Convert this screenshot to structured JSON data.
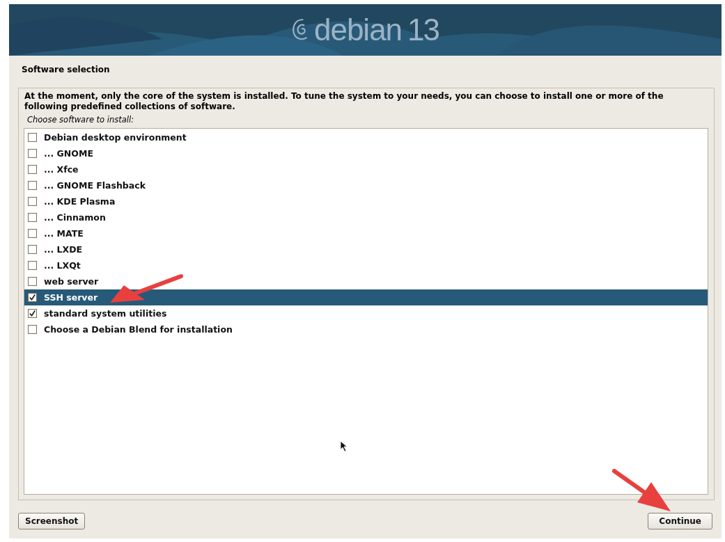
{
  "banner": {
    "logo_word": "debian",
    "logo_version": "13"
  },
  "title": "Software selection",
  "description": "At the moment, only the core of the system is installed. To tune the system to your needs, you can choose to install one or more of the following predefined collections of software.",
  "prompt": "Choose software to install:",
  "items": [
    {
      "label": "Debian desktop environment",
      "checked": false,
      "selected": false
    },
    {
      "label": "... GNOME",
      "checked": false,
      "selected": false
    },
    {
      "label": "... Xfce",
      "checked": false,
      "selected": false
    },
    {
      "label": "... GNOME Flashback",
      "checked": false,
      "selected": false
    },
    {
      "label": "... KDE Plasma",
      "checked": false,
      "selected": false
    },
    {
      "label": "... Cinnamon",
      "checked": false,
      "selected": false
    },
    {
      "label": "... MATE",
      "checked": false,
      "selected": false
    },
    {
      "label": "... LXDE",
      "checked": false,
      "selected": false
    },
    {
      "label": "... LXQt",
      "checked": false,
      "selected": false
    },
    {
      "label": "web server",
      "checked": false,
      "selected": false
    },
    {
      "label": "SSH server",
      "checked": true,
      "selected": true
    },
    {
      "label": "standard system utilities",
      "checked": true,
      "selected": false
    },
    {
      "label": "Choose a Debian Blend for installation",
      "checked": false,
      "selected": false
    }
  ],
  "buttons": [
    {
      "label": "Screenshot"
    },
    {
      "label": "Continue"
    }
  ]
}
